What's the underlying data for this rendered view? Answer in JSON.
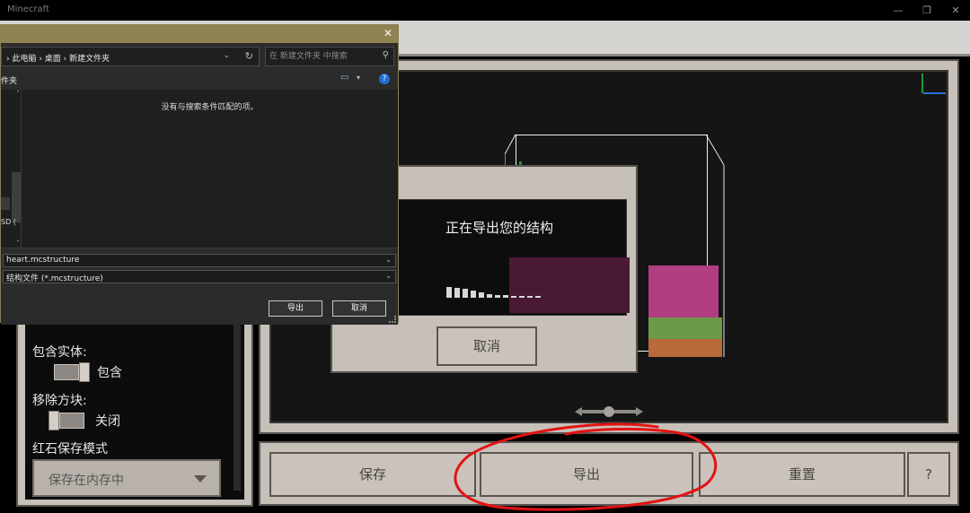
{
  "window": {
    "title": "Minecraft",
    "controls": [
      "—",
      "❐",
      "✕"
    ]
  },
  "structure_settings": {
    "include_entities_label": "包含实体:",
    "include_entities_value": "包含",
    "remove_blocks_label": "移除方块:",
    "remove_blocks_value": "关闭",
    "redstone_mode_label": "红石保存模式",
    "redstone_mode_value": "保存在内存中"
  },
  "export_modal": {
    "message": "正在导出您的结构",
    "cancel_label": "取消",
    "progress_fraction": 0.55
  },
  "actions": {
    "save_label": "保存",
    "export_label": "导出",
    "reset_label": "重置",
    "help_label": "?"
  },
  "save_dialog": {
    "breadcrumb": "›  此电脑  ›  桌面  ›  新建文件夹",
    "search_placeholder": "在 新建文件夹 中搜索",
    "folder_label": "件夹",
    "empty_message": "没有与搜索条件匹配的项。",
    "nav_drive": "SD (",
    "filename": "heart.mcstructure",
    "filetype": "结构文件 (*.mcstructure)",
    "export_button": "导出",
    "cancel_button": "取消",
    "help": "?"
  },
  "colors": {
    "annotation": "#e31212",
    "dialog_title": "#8f8451",
    "panel": "#c6c0b9"
  }
}
